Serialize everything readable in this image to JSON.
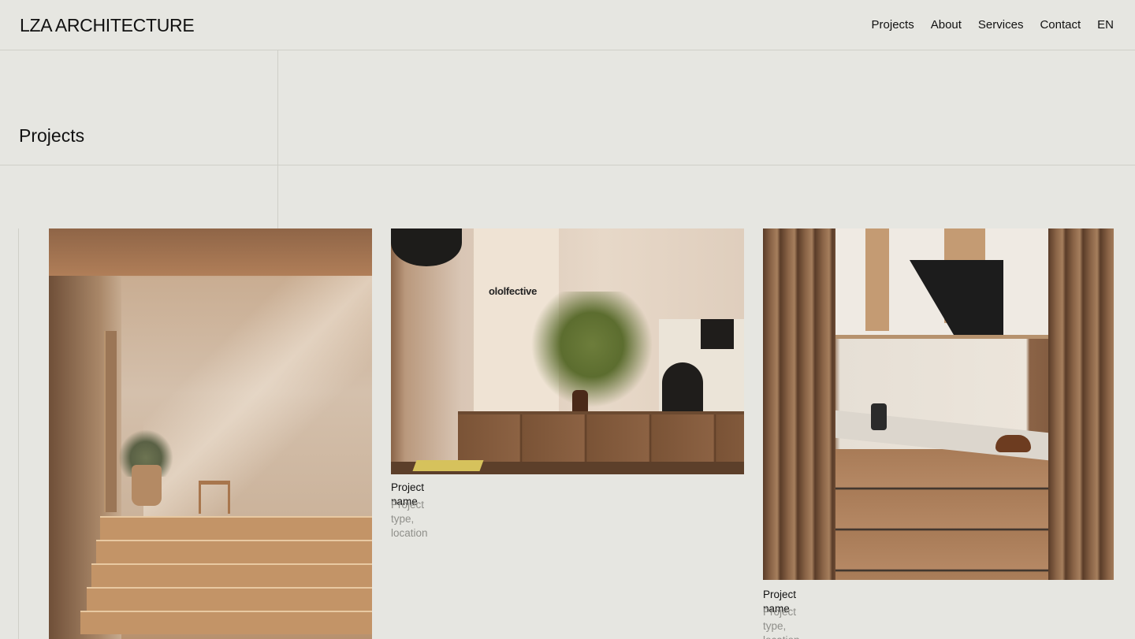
{
  "header": {
    "logo": "LZA ARCHITECTURE",
    "nav": [
      "Projects",
      "About",
      "Services",
      "Contact",
      "EN"
    ]
  },
  "page": {
    "title": "Projects"
  },
  "projects": [
    {
      "name": "",
      "type": ""
    },
    {
      "name": "Project name",
      "type": "Project type, location",
      "sign_text": "ololfective"
    },
    {
      "name": "Project name",
      "type": "Project type, location"
    }
  ]
}
